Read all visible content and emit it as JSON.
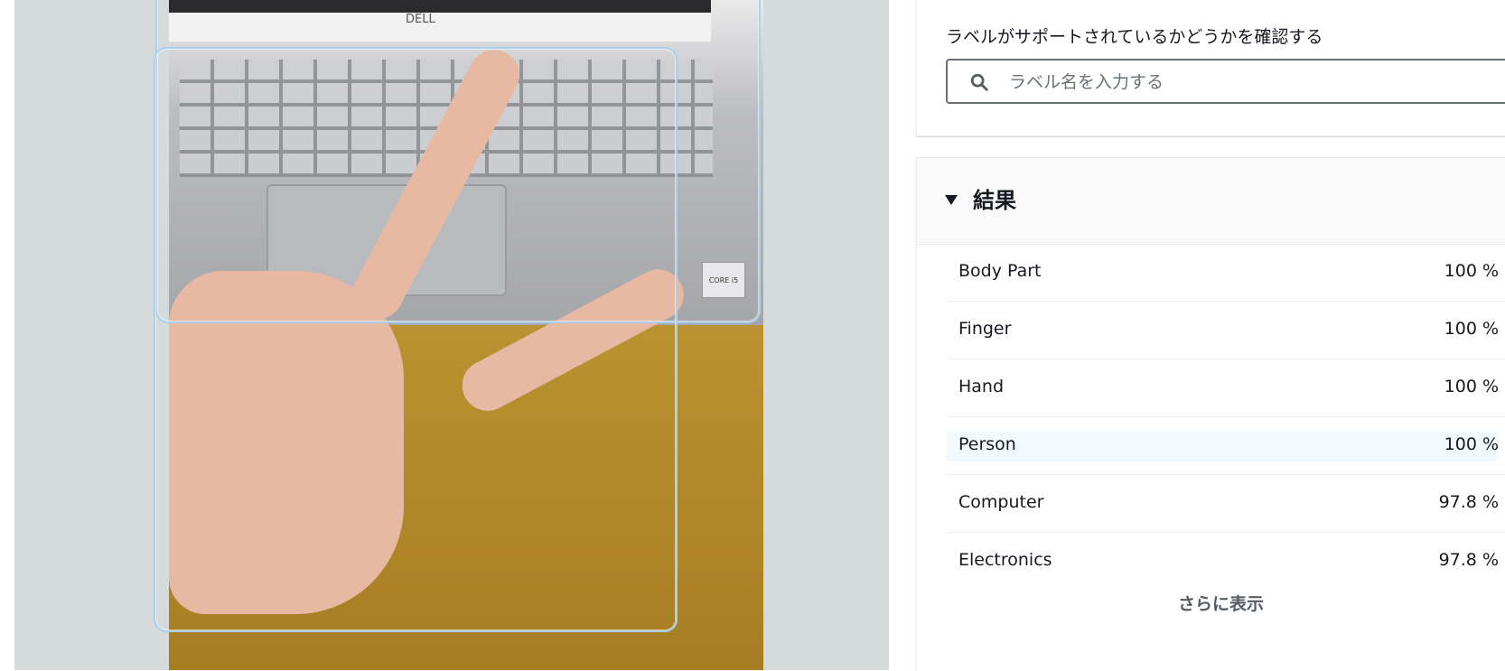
{
  "photo": {
    "brand_text": "DELL",
    "sticker_text": "CORE i5"
  },
  "search": {
    "label": "ラベルがサポートされているかどうかを確認する",
    "placeholder": "ラベル名を入力する",
    "value": ""
  },
  "results": {
    "title": "結果",
    "items": [
      {
        "name": "Body Part",
        "confidence": "100 %"
      },
      {
        "name": "Finger",
        "confidence": "100 %"
      },
      {
        "name": "Hand",
        "confidence": "100 %"
      },
      {
        "name": "Person",
        "confidence": "100 %"
      },
      {
        "name": "Computer",
        "confidence": "97.8 %"
      },
      {
        "name": "Electronics",
        "confidence": "97.8 %"
      }
    ],
    "show_more_label": "さらに表示"
  },
  "icons": {
    "search": "search-icon",
    "caret": "caret-down-icon"
  },
  "colors": {
    "panel_background": "#d5dbdb",
    "bounding_box": "#aad0f0",
    "highlight_row": "#f1faff",
    "text": "#16191f"
  }
}
